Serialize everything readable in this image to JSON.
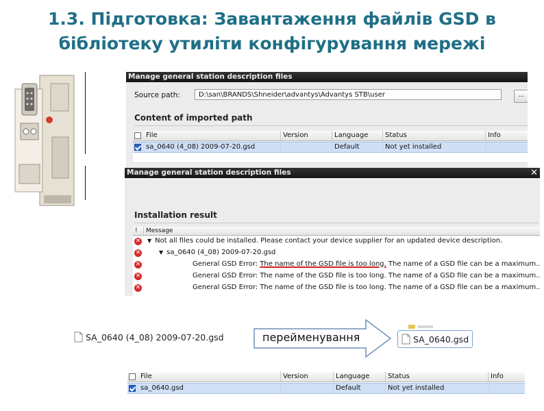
{
  "slide": {
    "title_line1": "1.3. Підготовка: Завантаження файлів GSD в",
    "title_line2": "бібліотеку утиліти конфігурування мережі"
  },
  "dialog1": {
    "title": "Manage general station description files",
    "source_label": "Source path:",
    "source_value": "D:\\san\\BRANDS\\Shneider\\advantys\\Advantys STB\\user",
    "browse_label": "...",
    "content_heading": "Content of imported path",
    "columns": [
      "File",
      "Version",
      "Language",
      "Status",
      "Info"
    ],
    "rows": [
      {
        "file": "sa_0640 (4_08) 2009-07-20.gsd",
        "version": "",
        "language": "Default",
        "status": "Not yet installed",
        "info": "",
        "checked": true
      }
    ]
  },
  "dialog2": {
    "title": "Manage general station description files",
    "close_label": "✕",
    "result_heading": "Installation result",
    "columns": [
      "!",
      "Message"
    ],
    "messages": [
      {
        "text": "Not all files could be installed. Please contact your device supplier for an updated device description.",
        "level": 0,
        "expander": "▼"
      },
      {
        "text": "sa_0640 (4_08) 2009-07-20.gsd",
        "level": 1,
        "expander": "▼"
      },
      {
        "prefix": "General GSD Error: ",
        "highlight": "The name of the GSD file is too long.",
        "suffix": " The name of a GSD file can be a maximum...",
        "level": 2
      },
      {
        "prefix": "General GSD Error: ",
        "highlight": "The name of the GSD file is too long.",
        "suffix": " The name of a GSD file can be a maximum...",
        "level": 2
      },
      {
        "prefix": "General GSD Error: ",
        "highlight": "The name of the GSD file is too long.",
        "suffix": " The name of a GSD file can be a maximum...",
        "level": 2
      }
    ]
  },
  "rename": {
    "old_name": "SA_0640 (4_08) 2009-07-20.gsd",
    "arrow_label": "перейменування",
    "new_name": "SA_0640.gsd"
  },
  "table3": {
    "columns": [
      "File",
      "Version",
      "Language",
      "Status",
      "Info"
    ],
    "rows": [
      {
        "file": "sa_0640.gsd",
        "version": "",
        "language": "Default",
        "status": "Not yet installed",
        "info": "",
        "checked": true
      }
    ]
  },
  "colors": {
    "title": "#1f6f86",
    "dialog_bg": "#ececec",
    "titlebar": "#1c1c1c",
    "selection": "#cfe0f6",
    "error": "#d62a2a",
    "underline": "#d21f1f"
  }
}
